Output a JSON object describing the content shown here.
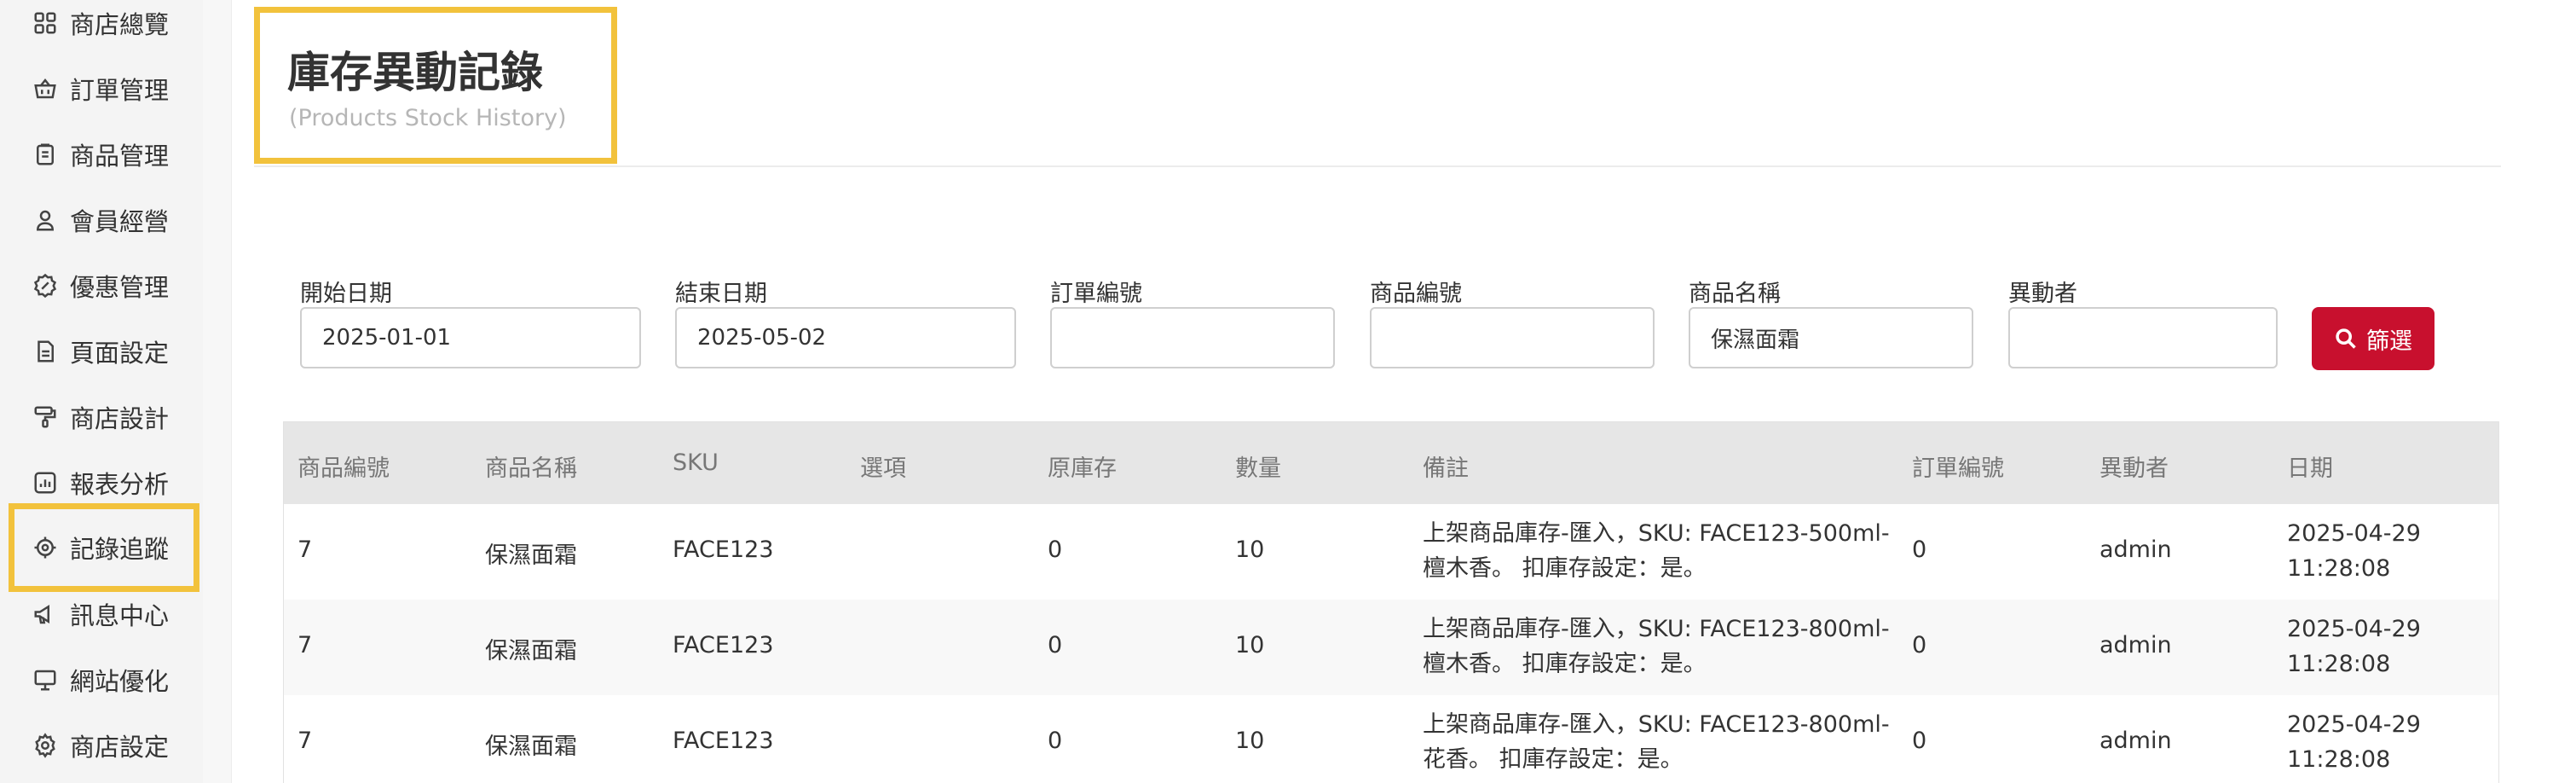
{
  "sidebar": {
    "items": [
      {
        "label": "商店總覽",
        "icon": "dashboard-grid-icon"
      },
      {
        "label": "訂單管理",
        "icon": "basket-icon"
      },
      {
        "label": "商品管理",
        "icon": "clipboard-icon"
      },
      {
        "label": "會員經營",
        "icon": "user-icon"
      },
      {
        "label": "優惠管理",
        "icon": "discount-badge-icon"
      },
      {
        "label": "頁面設定",
        "icon": "page-icon"
      },
      {
        "label": "商店設計",
        "icon": "paint-roller-icon"
      },
      {
        "label": "報表分析",
        "icon": "chart-icon"
      },
      {
        "label": "記錄追蹤",
        "icon": "target-icon",
        "active": true
      },
      {
        "label": "訊息中心",
        "icon": "megaphone-icon"
      },
      {
        "label": "網站優化",
        "icon": "monitor-icon"
      },
      {
        "label": "商店設定",
        "icon": "gear-icon"
      }
    ]
  },
  "header": {
    "title": "庫存異動記錄",
    "subtitle": "(Products Stock History)"
  },
  "filters": {
    "start_date": {
      "label": "開始日期",
      "value": "2025-01-01"
    },
    "end_date": {
      "label": "結束日期",
      "value": "2025-05-02"
    },
    "order_no": {
      "label": "訂單編號",
      "value": ""
    },
    "product_no": {
      "label": "商品編號",
      "value": ""
    },
    "product_name": {
      "label": "商品名稱",
      "value": "保濕面霜"
    },
    "operator": {
      "label": "異動者",
      "value": ""
    },
    "button_label": "篩選"
  },
  "table": {
    "columns": [
      "商品編號",
      "商品名稱",
      "SKU",
      "選項",
      "原庫存",
      "數量",
      "備註",
      "訂單編號",
      "異動者",
      "日期"
    ],
    "rows": [
      {
        "product_no": "7",
        "product_name": "保濕面霜",
        "sku": "FACE123",
        "option": "",
        "orig_stock": "0",
        "qty": "10",
        "note1": "上架商品庫存-匯入，SKU: FACE123-500ml-",
        "note2": "檀木香。 扣庫存設定：是。",
        "order_no": "0",
        "operator": "admin",
        "date": "2025-04-29",
        "time": "11:28:08"
      },
      {
        "product_no": "7",
        "product_name": "保濕面霜",
        "sku": "FACE123",
        "option": "",
        "orig_stock": "0",
        "qty": "10",
        "note1": "上架商品庫存-匯入，SKU: FACE123-800ml-",
        "note2": "檀木香。 扣庫存設定：是。",
        "order_no": "0",
        "operator": "admin",
        "date": "2025-04-29",
        "time": "11:28:08"
      },
      {
        "product_no": "7",
        "product_name": "保濕面霜",
        "sku": "FACE123",
        "option": "",
        "orig_stock": "0",
        "qty": "10",
        "note1": "上架商品庫存-匯入，SKU: FACE123-800ml-",
        "note2": "花香。 扣庫存設定：是。",
        "order_no": "0",
        "operator": "admin",
        "date": "2025-04-29",
        "time": "11:28:08"
      }
    ]
  },
  "colors": {
    "accent": "#c8102e",
    "highlight": "#f2c23c"
  }
}
